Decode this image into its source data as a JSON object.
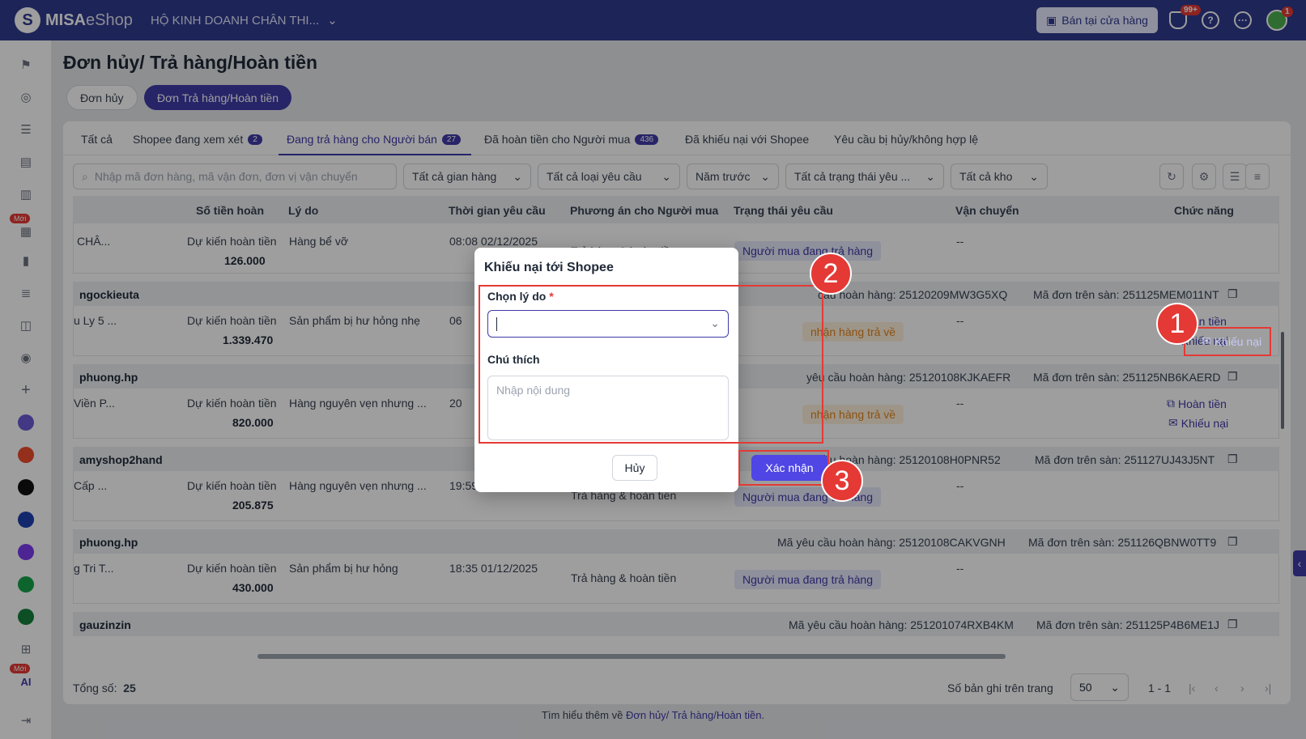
{
  "app": {
    "logo_mark": "S",
    "logo_brand": "MISA",
    "logo_product": "eShop",
    "shop_name": "HỘ KINH DOANH CHÂN THI...",
    "sell_button": "Bán tại cửa hàng",
    "notif_count": "99+",
    "avatar_badge": "1"
  },
  "sidebar": {
    "new_badge": "Mới",
    "ai_label": "AI"
  },
  "page": {
    "title": "Đơn hủy/ Trả hàng/Hoàn tiền",
    "pills": [
      "Đơn hủy",
      "Đơn Trả hàng/Hoàn tiền"
    ]
  },
  "tabs": [
    {
      "label": "Tất cả",
      "count": ""
    },
    {
      "label": "Shopee đang xem xét",
      "count": "2"
    },
    {
      "label": "Đang trả hàng cho Người bán",
      "count": "27"
    },
    {
      "label": "Đã hoàn tiền cho Người mua",
      "count": "436"
    },
    {
      "label": "Đã khiếu nại với Shopee",
      "count": ""
    },
    {
      "label": "Yêu cầu bị hủy/không hợp lệ",
      "count": ""
    }
  ],
  "filters": {
    "search_placeholder": "Nhập mã đơn hàng, mã vận đơn, đơn vị vận chuyển",
    "shop": "Tất cả gian hàng",
    "type": "Tất cả loại yêu cầu",
    "period": "Năm trước",
    "status": "Tất cả trạng thái yêu ...",
    "warehouse": "Tất cả kho"
  },
  "columns": [
    "Số tiền hoàn",
    "Lý do",
    "Thời gian yêu cầu",
    "Phương án cho Người mua",
    "Trạng thái yêu cầu",
    "Vận chuyển",
    "Chức năng"
  ],
  "labels": {
    "expected_refund": "Dự kiến hoàn tiền",
    "refund_action": "Hoàn tiền",
    "complaint_action": "Khiếu nại",
    "dash": "--"
  },
  "orders": [
    {
      "buyer": "",
      "product": "CHÂ...",
      "amount": "126.000",
      "reason": "Hàng bể vỡ",
      "time": "08:08 02/12/2025",
      "option": "Trả hàng & hoàn tiền",
      "status": "Người mua đang trả hàng",
      "status_color": "blue",
      "request_id": "",
      "order_id": ""
    },
    {
      "buyer": "ngockieuta",
      "product": "u Ly 5 ...",
      "amount": "1.339.470",
      "reason": "Sản phẩm bị hư hỏng nhẹ",
      "time": "06",
      "option": "",
      "status": "nhận hàng trả về",
      "status_color": "orange",
      "request_id": "cầu hoàn hàng: 25120209MW3G5XQ",
      "order_id": "Mã đơn trên sàn: 251125MEM011NT"
    },
    {
      "buyer": "phuong.hp",
      "product": "Viền P...",
      "amount": "820.000",
      "reason": "Hàng nguyên vẹn nhưng ...",
      "time": "20",
      "option": "",
      "status": "nhận hàng trả về",
      "status_color": "orange",
      "request_id": "yêu cầu hoàn hàng: 25120108KJKAEFR",
      "order_id": "Mã đơn trên sàn: 251125NB6KAERD"
    },
    {
      "buyer": "amyshop2hand",
      "product": "Cấp ...",
      "amount": "205.875",
      "reason": "Hàng nguyên vẹn nhưng ...",
      "time": "19:59 01/12/2025",
      "option": "Trả hàng & hoàn tiền",
      "status": "Người mua đang trả hàng",
      "status_color": "blue",
      "request_id": "cầu hoàn hàng: 25120108H0PNR52",
      "order_id": "Mã đơn trên sàn: 251127UJ43J5NT"
    },
    {
      "buyer": "phuong.hp",
      "product": "g Tri T...",
      "amount": "430.000",
      "reason": "Sản phẩm bị hư hỏng",
      "time": "18:35 01/12/2025",
      "option": "Trả hàng & hoàn tiền",
      "status": "Người mua đang trả hàng",
      "status_color": "blue",
      "request_id": "Mã yêu cầu hoàn hàng: 25120108CAKVGNH",
      "order_id": "Mã đơn trên sàn: 251126QBNW0TT9"
    },
    {
      "buyer": "gauzinzin",
      "product": "",
      "amount": "",
      "reason": "",
      "time": "",
      "option": "",
      "status": "",
      "status_color": "",
      "request_id": "Mã yêu cầu hoàn hàng: 251201074RXB4KM",
      "order_id": "Mã đơn trên sàn: 251125P4B6ME1J"
    }
  ],
  "footer": {
    "total_label": "Tổng số:",
    "total_value": "25",
    "per_page_label": "Số bản ghi trên trang",
    "per_page_value": "50",
    "range": "1 - 1"
  },
  "help": {
    "text": "Tìm hiểu thêm về",
    "link": "Đơn hủy/ Trả hàng/Hoàn tiền."
  },
  "modal": {
    "title": "Khiếu nại tới Shopee",
    "reason_label": "Chọn lý do",
    "required_mark": "*",
    "note_label": "Chú thích",
    "note_placeholder": "Nhập nội dung",
    "cancel": "Hủy",
    "confirm": "Xác nhận"
  },
  "steps": [
    "1",
    "2",
    "3"
  ],
  "colors": {
    "brand": "#2f3a8f",
    "accent": "#3f3aa8",
    "primary_button": "#4f46e5",
    "annotation": "#e53935",
    "status_blue": "#3f3aa8",
    "status_orange": "#e0851b"
  }
}
